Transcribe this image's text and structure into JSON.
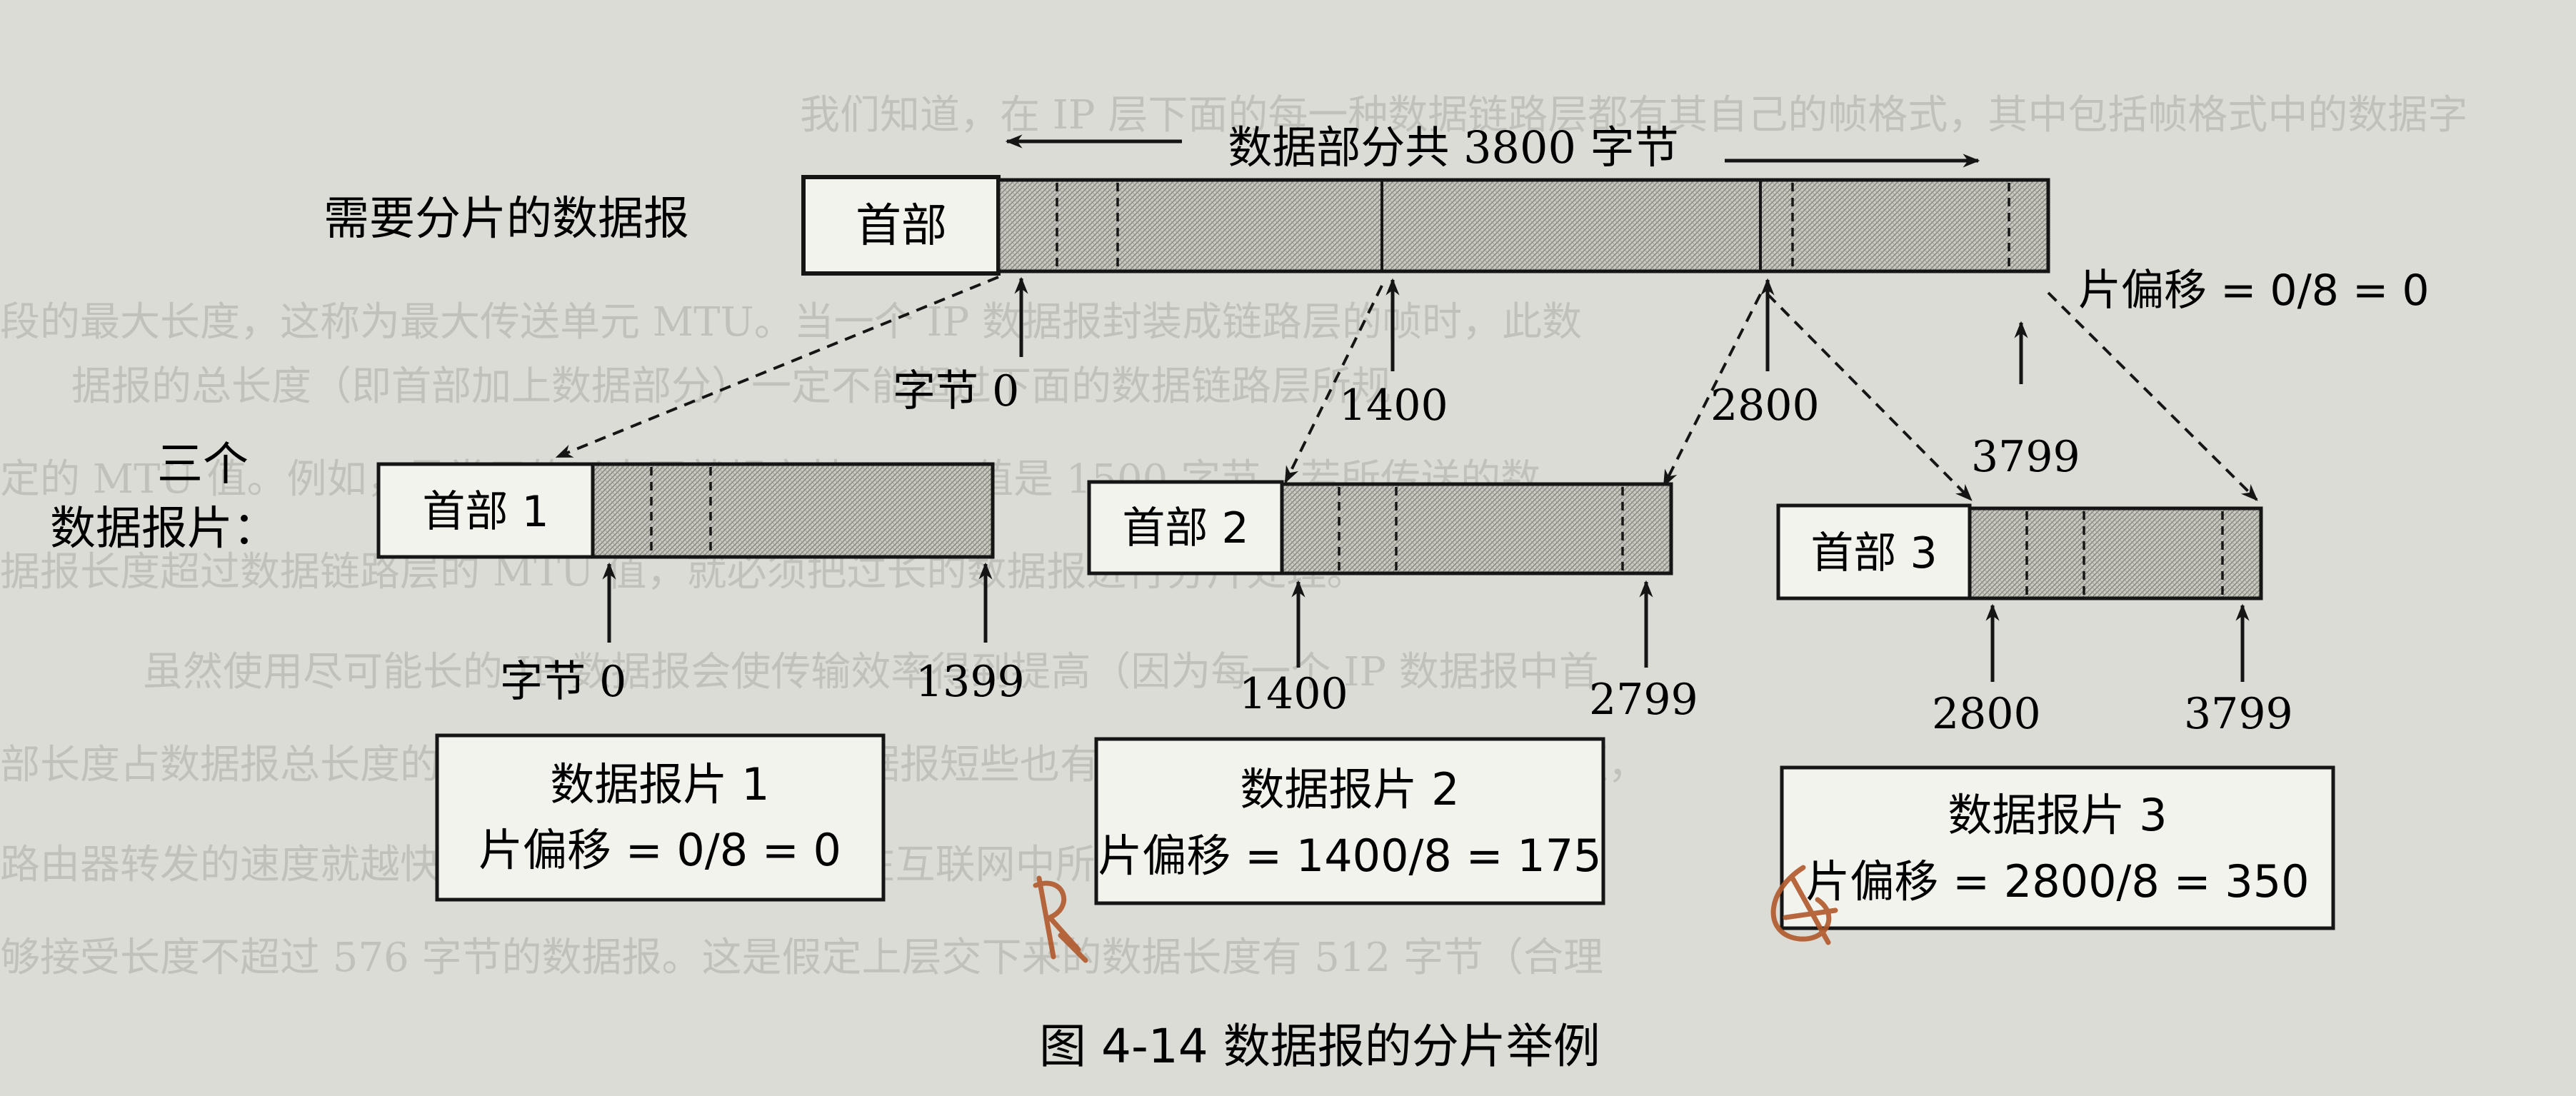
{
  "figure": {
    "total_label": "数据部分共 3800 字节",
    "original_label": "需要分片的数据报",
    "header_label": "首部",
    "three_label_line1": "三个",
    "three_label_line2": "数据报片：",
    "original_offset": "片偏移 = 0/8 = 0",
    "caption": "图 4-14    数据报的分片举例"
  },
  "original_ticks": [
    {
      "label": "字节 0"
    },
    {
      "label": "1400"
    },
    {
      "label": "2800"
    },
    {
      "label": "3799"
    }
  ],
  "fragments": [
    {
      "header": "首部 1",
      "start_label": "字节 0",
      "end_label": "1399",
      "box_title": "数据报片 1",
      "box_offset": "片偏移 = 0/8 = 0"
    },
    {
      "header": "首部 2",
      "start_label": "1400",
      "end_label": "2799",
      "box_title": "数据报片 2",
      "box_offset": "片偏移 = 1400/8 = 175"
    },
    {
      "header": "首部 3",
      "start_label": "2800",
      "end_label": "3799",
      "box_title": "数据报片 3",
      "box_offset": "片偏移 = 2800/8 = 350"
    }
  ],
  "background_text": [
    "我们知道，在 IP 层下面的每一种数据链路层都有其自己的帧格式，其中包括帧格式中的数据字",
    "段的最大长度，这称为最大传送单元 MTU。当一个 IP 数据报封装成链路层的帧时，此数",
    "据报的总长度（即首部加上数据部分）一定不能超过下面的数据链路层所规",
    "定的 MTU 值。例如，最常用的以太网就规定其 MTU 值是 1500 字节。若所传送的数",
    "据报长度超过数据链路层的 MTU 值，就必须把过长的数据报进行分片处理。",
    "虽然使用尽可能长的 IP 数据报会使传输效率得到提高（因为每一个 IP 数据报中首",
    "部长度占数据报总长度的比例就会小一些），但数据报短些也有好处。每一个 IP 数据报越短，",
    "路由器转发的速度就越快。为此，IP 协议规定，在互联网中所有的主机和路由器，必须能",
    "够接受长度不超过 576 字节的数据报。这是假定上层交下来的数据长度有 512 字节（合理"
  ]
}
